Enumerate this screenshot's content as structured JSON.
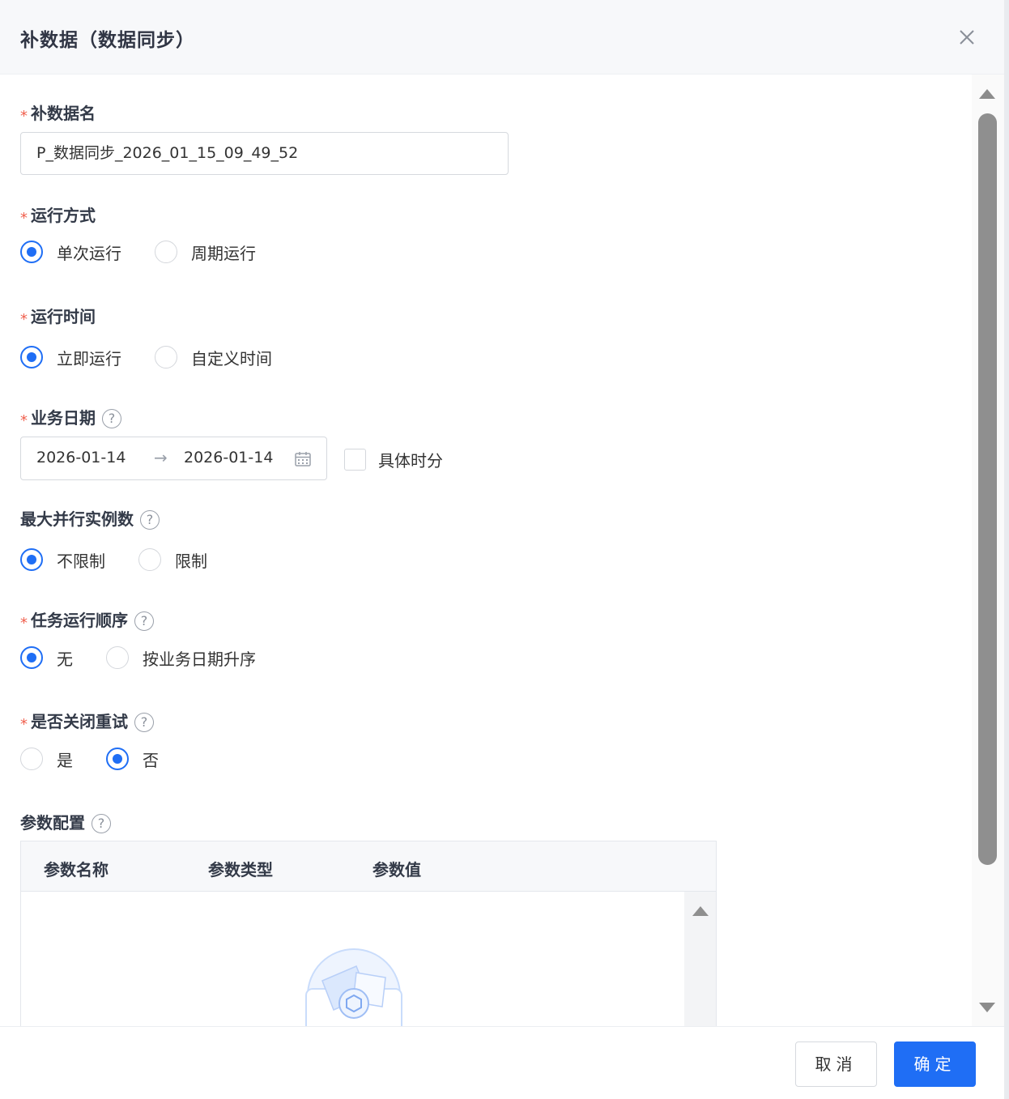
{
  "dialog": {
    "title": "补数据（数据同步）"
  },
  "form": {
    "name": {
      "required_mark": "*",
      "label": "补数据名",
      "value": "P_数据同步_2026_01_15_09_49_52"
    },
    "run_mode": {
      "required_mark": "*",
      "label": "运行方式",
      "options": [
        "单次运行",
        "周期运行"
      ],
      "selected": "单次运行"
    },
    "run_time": {
      "required_mark": "*",
      "label": "运行时间",
      "options": [
        "立即运行",
        "自定义时间"
      ],
      "selected": "立即运行"
    },
    "business_date": {
      "required_mark": "*",
      "label": "业务日期",
      "help": "?",
      "start": "2026-01-14",
      "separator": "→",
      "end": "2026-01-14",
      "checkbox_label": "具体时分",
      "checkbox_checked": false
    },
    "max_parallel": {
      "label": "最大并行实例数",
      "help": "?",
      "options": [
        "不限制",
        "限制"
      ],
      "selected": "不限制"
    },
    "task_order": {
      "required_mark": "*",
      "label": "任务运行顺序",
      "help": "?",
      "options": [
        "无",
        "按业务日期升序"
      ],
      "selected": "无"
    },
    "close_retry": {
      "required_mark": "*",
      "label": "是否关闭重试",
      "help": "?",
      "options": [
        "是",
        "否"
      ],
      "selected": "否"
    },
    "params": {
      "label": "参数配置",
      "help": "?",
      "columns": [
        "参数名称",
        "参数类型",
        "参数值"
      ]
    }
  },
  "footer": {
    "cancel_label": "取消",
    "ok_label": "确定"
  },
  "colors": {
    "primary": "#1f6ef5",
    "required": "#f0604e"
  }
}
